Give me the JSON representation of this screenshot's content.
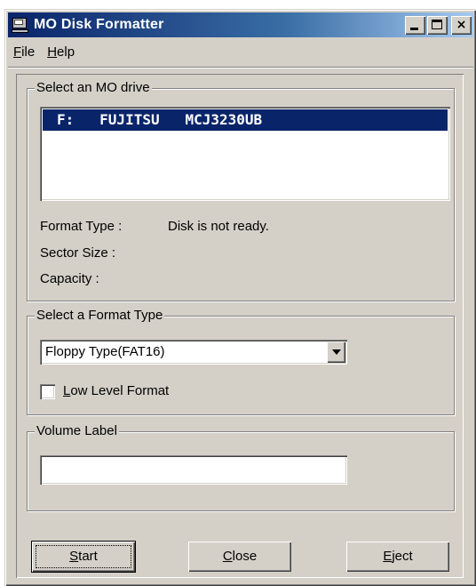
{
  "window": {
    "title": "MO Disk Formatter",
    "icon": "computer-icon",
    "controls": {
      "minimize": "minimize-icon",
      "maximize": "maximize-icon",
      "close": "×"
    }
  },
  "menu": [
    {
      "accel": "F",
      "rest": "ile"
    },
    {
      "accel": "H",
      "rest": "elp"
    }
  ],
  "drive_group": {
    "label": "Select an MO drive",
    "selected_drive": "F:   FUJITSU   MCJ3230UB",
    "format_type_label": "Format Type :",
    "format_type_value": "Disk is not ready.",
    "sector_size_label": "Sector Size :",
    "sector_size_value": "",
    "capacity_label": "Capacity :",
    "capacity_value": ""
  },
  "format_group": {
    "label": "Select a Format Type",
    "selected": "Floppy Type(FAT16)",
    "low_level_checked": false,
    "low_level_accel": "L",
    "low_level_rest": "ow Level Format"
  },
  "volume_group": {
    "label": "Volume Label",
    "value": ""
  },
  "buttons": {
    "start_accel": "S",
    "start_rest": "tart",
    "close_accel": "C",
    "close_rest": "lose",
    "eject_accel": "E",
    "eject_rest": "ject"
  },
  "colors": {
    "face": "#d4d0c8",
    "title_start": "#0a246a",
    "title_end": "#a6caf0",
    "selection": "#0a246a"
  }
}
